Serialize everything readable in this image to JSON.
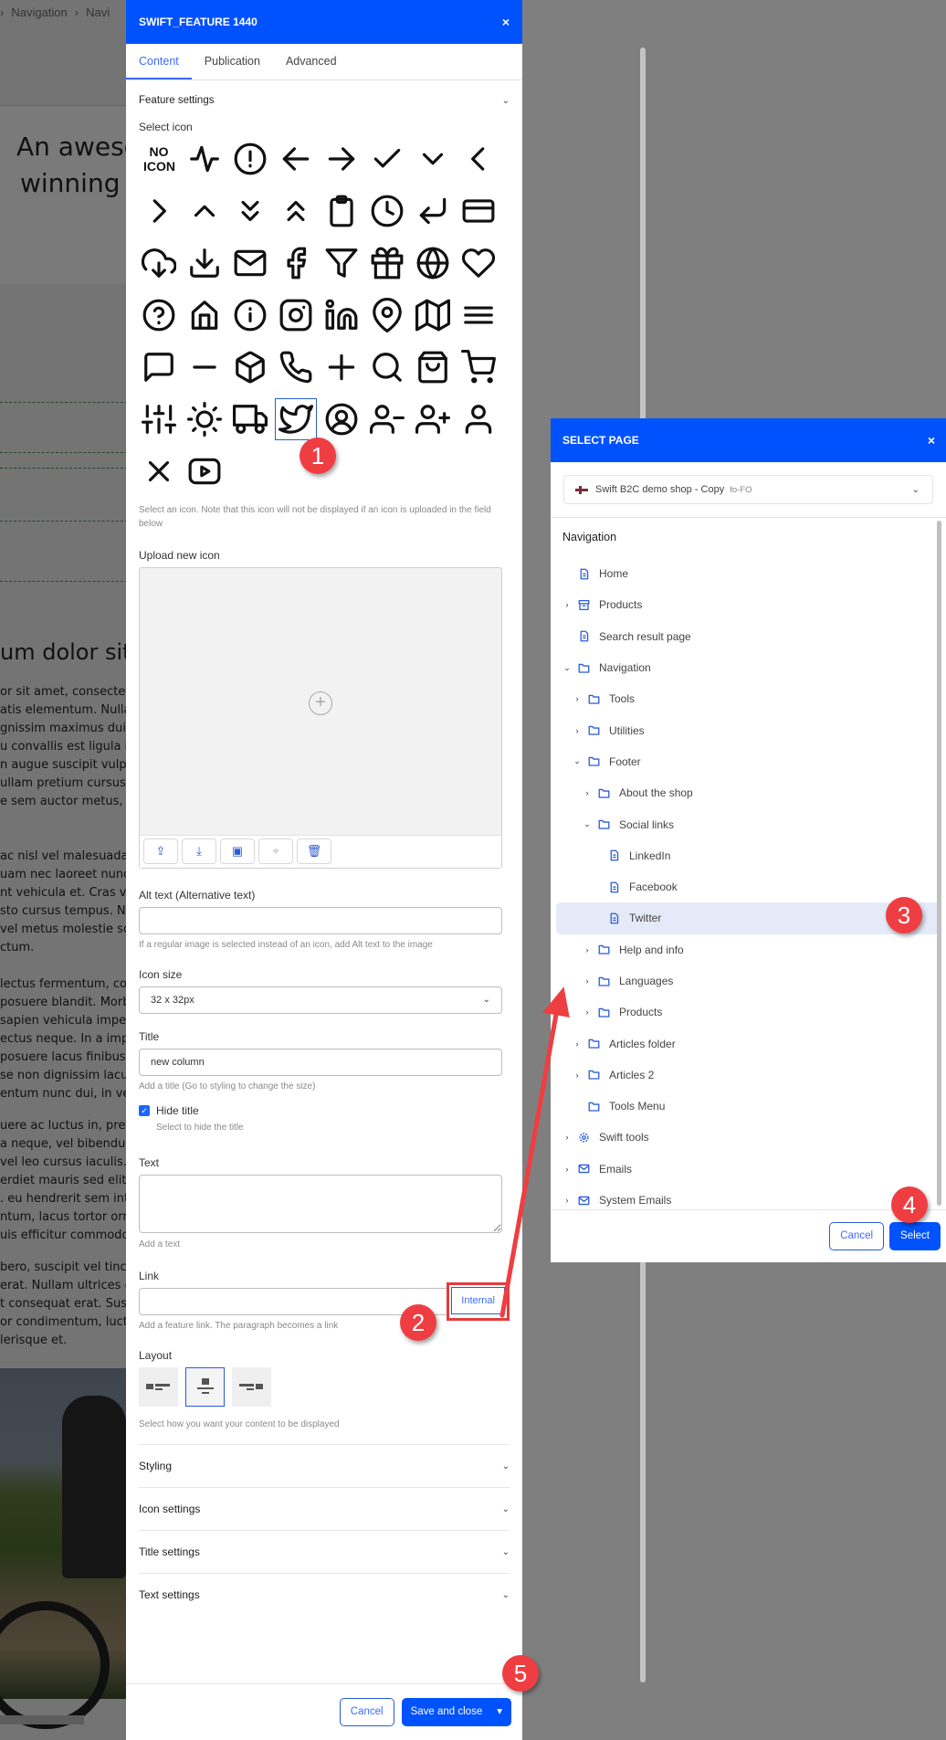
{
  "background": {
    "breadcrumb": [
      "Navigation",
      "Navi"
    ],
    "hero_lines": [
      "An awesc",
      "winning"
    ],
    "heading": "um dolor sit",
    "paragraphs": [
      [
        "or sit amet, consectetu",
        "atis elementum. Nulla",
        "gnissim maximus dui. A",
        "u convallis est ligula id",
        "n augue suscipit vulpu",
        "ullam pretium cursus",
        "e sem auctor metus, ac"
      ],
      [
        "ac nisl vel malesuada.",
        "uam nec laoreet nunc.",
        "nt vehicula et. Cras vel",
        "sto cursus tempus. Na",
        "vel metus molestie so",
        "ctum."
      ],
      [
        "lectus fermentum, con",
        "posuere blandit. Morb",
        "sapien vehicula imper",
        "ectus neque. In a impe",
        "posuere lacus finibus. V",
        "se non dignissim lacu",
        "entum nunc dui, in ves"
      ],
      [
        "uere ac luctus in, preti",
        "a neque, vel bibendum",
        "vel leo cursus iaculis.",
        "erdiet mauris sed elit a",
        ". eu hendrerit sem inte",
        "ntum, lacus tortor orna",
        "uis efficitur commodo,"
      ],
      [
        "bero, suscipit vel tincid",
        "erat. Nullam ultrices e",
        "t consequat erat. Susp",
        "or condimentum, luctu",
        "lerisque et."
      ]
    ]
  },
  "editor": {
    "title": "SWIFT_FEATURE 1440",
    "close_icon": "×",
    "tabs": [
      {
        "label": "Content",
        "active": true
      },
      {
        "label": "Publication",
        "active": false
      },
      {
        "label": "Advanced",
        "active": false
      }
    ],
    "feature_settings_label": "Feature settings",
    "select_icon_label": "Select icon",
    "no_icon_label": "NO ICON",
    "icons": [
      "no-icon",
      "activity",
      "alert-circle",
      "arrow-left",
      "arrow-right",
      "check",
      "chevron-down",
      "chevron-left",
      "chevron-right",
      "chevron-up",
      "chevrons-down",
      "chevrons-up",
      "clipboard",
      "clock",
      "corner-down-left",
      "credit-card",
      "download-cloud",
      "download",
      "mail",
      "facebook",
      "filter",
      "gift",
      "globe",
      "heart",
      "help-circle",
      "home",
      "info",
      "instagram",
      "linkedin",
      "map-pin",
      "map",
      "menu",
      "message-square",
      "minus",
      "package",
      "phone",
      "plus",
      "search",
      "shopping-bag",
      "shopping-cart",
      "sliders",
      "sun",
      "truck",
      "twitter",
      "user-circle",
      "user-minus",
      "user-plus",
      "user",
      "x",
      "youtube"
    ],
    "selected_icon": "twitter",
    "select_icon_hint": "Select an icon. Note that this icon will not be displayed if an icon is uploaded in the field below",
    "upload_label": "Upload new icon",
    "upload_toolbar": [
      "upload-icon",
      "download-icon",
      "folder-plus-icon",
      "crosshair-icon",
      "trash-icon"
    ],
    "alt_text_label": "Alt text (Alternative text)",
    "alt_text_value": "",
    "alt_text_hint": "If a regular image is selected instead of an icon, add Alt text to the image",
    "icon_size_label": "Icon size",
    "icon_size_value": "32 x 32px",
    "title_label": "Title",
    "title_value": "new column",
    "title_hint": "Add a title (Go to styling to change the size)",
    "hide_title_label": "Hide title",
    "hide_title_checked": true,
    "hide_title_hint": "Select to hide the title",
    "text_label": "Text",
    "text_value": "",
    "text_hint": "Add a text",
    "link_label": "Link",
    "link_value": "",
    "link_button": "Internal",
    "link_hint": "Add a feature link. The paragraph becomes a link",
    "layout_label": "Layout",
    "layout_options": [
      "image-left",
      "image-top",
      "image-right"
    ],
    "layout_selected": "image-top",
    "layout_hint": "Select how you want your content to be displayed",
    "sections": [
      "Styling",
      "Icon settings",
      "Title settings",
      "Text settings"
    ],
    "cancel_label": "Cancel",
    "save_label": "Save and close",
    "save_dropdown_icon": "▾"
  },
  "select_page": {
    "title": "SELECT PAGE",
    "close_icon": "×",
    "site_name": "Swift B2C demo shop - Copy",
    "site_lang": "fo-FO",
    "tree_title": "Navigation",
    "tree": [
      {
        "label": "Home",
        "level": 0,
        "toggle": "",
        "icon": "page"
      },
      {
        "label": "Products",
        "level": 0,
        "toggle": "›",
        "icon": "archive"
      },
      {
        "label": "Search result page",
        "level": 0,
        "toggle": "",
        "icon": "page"
      },
      {
        "label": "Navigation",
        "level": 0,
        "toggle": "⌄",
        "icon": "folder"
      },
      {
        "label": "Tools",
        "level": 1,
        "toggle": "›",
        "icon": "folder"
      },
      {
        "label": "Utilities",
        "level": 1,
        "toggle": "›",
        "icon": "folder"
      },
      {
        "label": "Footer",
        "level": 1,
        "toggle": "⌄",
        "icon": "folder"
      },
      {
        "label": "About the shop",
        "level": 2,
        "toggle": "›",
        "icon": "folder"
      },
      {
        "label": "Social links",
        "level": 2,
        "toggle": "⌄",
        "icon": "folder"
      },
      {
        "label": "LinkedIn",
        "level": 3,
        "toggle": "",
        "icon": "page"
      },
      {
        "label": "Facebook",
        "level": 3,
        "toggle": "",
        "icon": "page"
      },
      {
        "label": "Twitter",
        "level": 3,
        "toggle": "",
        "icon": "page",
        "selected": true
      },
      {
        "label": "Help and info",
        "level": 2,
        "toggle": "›",
        "icon": "folder"
      },
      {
        "label": "Languages",
        "level": 2,
        "toggle": "›",
        "icon": "folder"
      },
      {
        "label": "Products",
        "level": 2,
        "toggle": "›",
        "icon": "folder"
      },
      {
        "label": "Articles folder",
        "level": 1,
        "toggle": "›",
        "icon": "folder"
      },
      {
        "label": "Articles 2",
        "level": 1,
        "toggle": "›",
        "icon": "folder"
      },
      {
        "label": "Tools Menu",
        "level": 1,
        "toggle": "",
        "icon": "folder"
      },
      {
        "label": "Swift tools",
        "level": 0,
        "toggle": "›",
        "icon": "gear"
      },
      {
        "label": "Emails",
        "level": 0,
        "toggle": "›",
        "icon": "mail"
      },
      {
        "label": "System Emails",
        "level": 0,
        "toggle": "›",
        "icon": "mail"
      }
    ],
    "cancel_label": "Cancel",
    "select_label": "Select"
  },
  "annotations": {
    "step1": "1",
    "step2": "2",
    "step3": "3",
    "step4": "4",
    "step5": "5",
    "color": "#ef3e42"
  },
  "colors": {
    "brand_blue": "#0052ff",
    "accent_blue": "#3d6bff",
    "selected_row": "#e4eaf7"
  }
}
